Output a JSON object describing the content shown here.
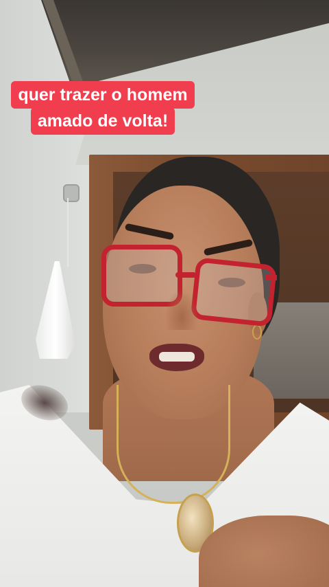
{
  "caption": {
    "line1": "quer trazer o homem",
    "line2": "amado de volta!"
  },
  "colors": {
    "caption_background": "#f03e4e",
    "caption_text": "#ffffff",
    "glasses_frame": "#c2232f"
  }
}
